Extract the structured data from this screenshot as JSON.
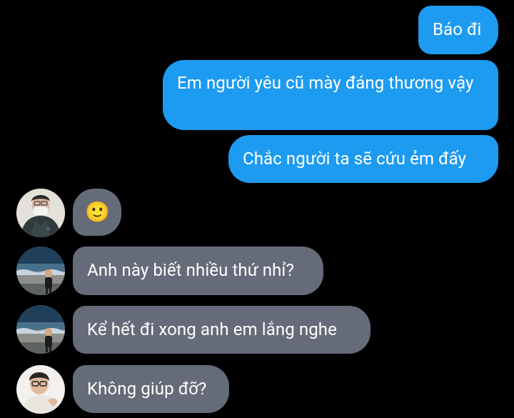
{
  "messages": {
    "outgoing": [
      {
        "text": "Báo đi"
      },
      {
        "text": "Em người yêu cũ mày đáng thương vậy"
      },
      {
        "text": "Chắc người ta sẽ cứu ẻm đấy"
      }
    ],
    "incoming": [
      {
        "text": "🙂",
        "avatar": "user-avatar-masked"
      },
      {
        "text": "Anh này biết nhiều thứ nhỉ?",
        "avatar": "user-avatar-beach"
      },
      {
        "text": "Kể hết đi xong anh em lắng nghe",
        "avatar": "user-avatar-beach"
      },
      {
        "text": "Không giúp đỡ?",
        "avatar": "user-avatar-glasses"
      }
    ]
  },
  "colors": {
    "background": "#000000",
    "outgoing_bubble": "#1d9bf0",
    "incoming_bubble": "#656b79",
    "text": "#ffffff"
  }
}
